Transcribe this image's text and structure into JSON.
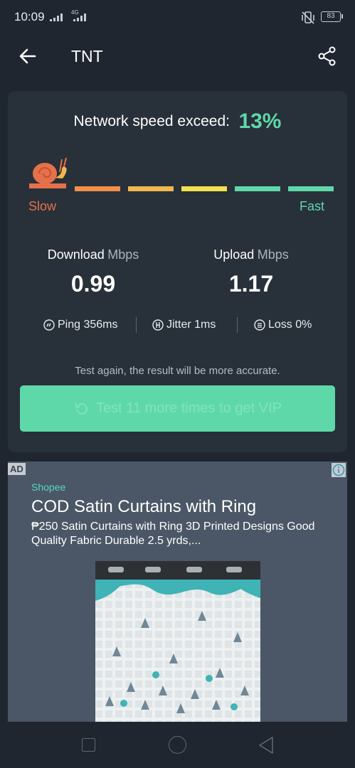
{
  "status_bar": {
    "time": "10:09",
    "network_tag": "4G",
    "battery": "83"
  },
  "header": {
    "title": "TNT",
    "back_icon": "arrow-left-icon",
    "share_icon": "share-icon"
  },
  "result": {
    "speed_label": "Network speed exceed:",
    "speed_value": "13%",
    "scale": {
      "slow_label": "Slow",
      "fast_label": "Fast",
      "colors": [
        "#e5714b",
        "#ef8f4a",
        "#f0b84e",
        "#f2e04e",
        "#5fd8a9",
        "#5fd8a9"
      ]
    },
    "download": {
      "label": "Download",
      "unit": "Mbps",
      "value": "0.99"
    },
    "upload": {
      "label": "Upload",
      "unit": "Mbps",
      "value": "1.17"
    },
    "stats": {
      "ping": "Ping 356ms",
      "jitter": "Jitter 1ms",
      "loss": "Loss 0%"
    },
    "hint": "Test again, the result will be more accurate.",
    "vip_button": "Test 11 more times to get VIP"
  },
  "ad": {
    "badge": "AD",
    "brand": "Shopee",
    "title": "COD Satin Curtains with Ring",
    "description": "₱250 Satin Curtains with Ring 3D Printed Designs Good Quality Fabric Durable 2.5 yrds,..."
  },
  "colors": {
    "accent": "#5fd8a9",
    "slow": "#e5714b",
    "background": "#1f2630",
    "card": "#283039",
    "ad_background": "#4b5766"
  }
}
